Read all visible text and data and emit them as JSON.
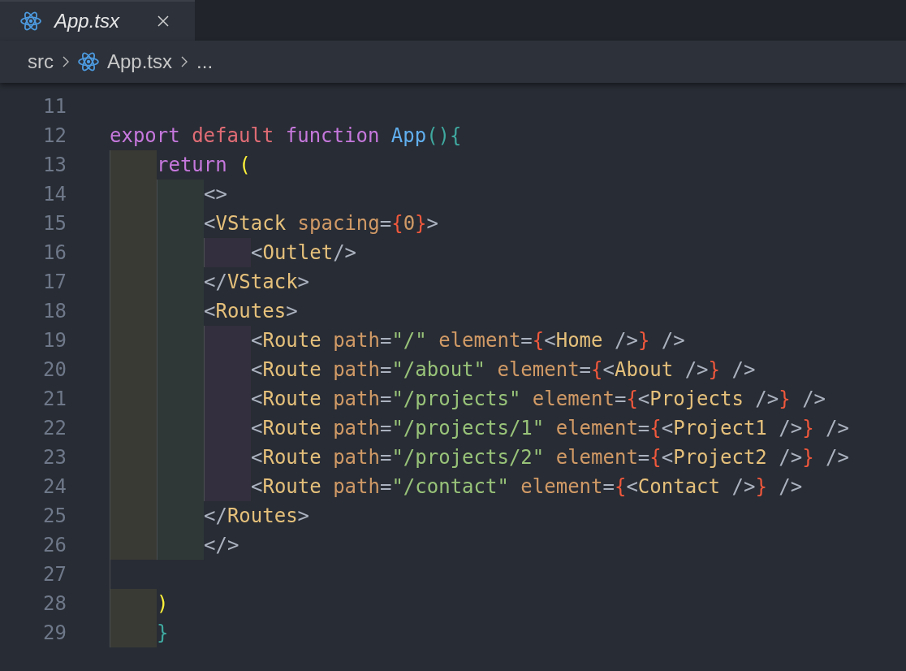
{
  "tab": {
    "title": "App.tsx",
    "selected": true
  },
  "breadcrumb": [
    {
      "label": "src",
      "kind": "folder"
    },
    {
      "label": "App.tsx",
      "kind": "file"
    },
    {
      "label": "...",
      "kind": "more"
    }
  ],
  "lines": [
    {
      "number": "11"
    },
    {
      "number": "12",
      "tokens": [
        {
          "text": "export",
          "kind": "keyword"
        },
        {
          "text": " default",
          "kind": "keyword-alt"
        },
        {
          "text": " function",
          "kind": "keyword"
        },
        {
          "text": " App",
          "kind": "function"
        },
        {
          "text": "(){",
          "kind": "bracket-teal"
        }
      ]
    },
    {
      "number": "13",
      "guides": [
        {
          "kind": "outer"
        }
      ],
      "tokens": [
        {
          "text": "return",
          "kind": "keyword"
        },
        {
          "text": " (",
          "kind": "bracket-yellow"
        }
      ]
    },
    {
      "number": "14",
      "guides": [
        {
          "kind": "outer"
        },
        {
          "kind": "middle"
        }
      ],
      "tokens": [
        {
          "text": "<>",
          "kind": "punct"
        }
      ]
    },
    {
      "number": "15",
      "guides": [
        {
          "kind": "outer"
        },
        {
          "kind": "middle"
        }
      ],
      "tokens": [
        {
          "text": "<",
          "kind": "punct"
        },
        {
          "text": "VStack",
          "kind": "tag"
        },
        {
          "text": " spacing",
          "kind": "attr"
        },
        {
          "text": "=",
          "kind": "punct"
        },
        {
          "text": "{",
          "kind": "brace"
        },
        {
          "text": "0",
          "kind": "attr"
        },
        {
          "text": "}",
          "kind": "brace"
        },
        {
          "text": ">",
          "kind": "punct"
        }
      ]
    },
    {
      "number": "16",
      "guides": [
        {
          "kind": "outer"
        },
        {
          "kind": "middle"
        },
        {
          "kind": "inner"
        }
      ],
      "tokens": [
        {
          "text": "<",
          "kind": "punct"
        },
        {
          "text": "Outlet",
          "kind": "tag"
        },
        {
          "text": "/>",
          "kind": "punct"
        }
      ]
    },
    {
      "number": "17",
      "guides": [
        {
          "kind": "outer"
        },
        {
          "kind": "middle"
        }
      ],
      "tokens": [
        {
          "text": "</",
          "kind": "punct"
        },
        {
          "text": "VStack",
          "kind": "tag"
        },
        {
          "text": ">",
          "kind": "punct"
        }
      ]
    },
    {
      "number": "18",
      "guides": [
        {
          "kind": "outer"
        },
        {
          "kind": "middle"
        }
      ],
      "tokens": [
        {
          "text": "<",
          "kind": "punct"
        },
        {
          "text": "Routes",
          "kind": "tag"
        },
        {
          "text": ">",
          "kind": "punct"
        }
      ]
    },
    {
      "number": "19",
      "guides": [
        {
          "kind": "outer"
        },
        {
          "kind": "middle"
        },
        {
          "kind": "inner"
        }
      ],
      "tokens": [
        {
          "text": "<",
          "kind": "punct"
        },
        {
          "text": "Route",
          "kind": "tag"
        },
        {
          "text": " path",
          "kind": "attr"
        },
        {
          "text": "=",
          "kind": "punct"
        },
        {
          "text": "\"/\"",
          "kind": "string"
        },
        {
          "text": " element",
          "kind": "attr"
        },
        {
          "text": "=",
          "kind": "punct"
        },
        {
          "text": "{",
          "kind": "brace"
        },
        {
          "text": "<",
          "kind": "punct"
        },
        {
          "text": "Home",
          "kind": "tag"
        },
        {
          "text": " />",
          "kind": "punct"
        },
        {
          "text": "}",
          "kind": "brace"
        },
        {
          "text": " />",
          "kind": "punct"
        }
      ]
    },
    {
      "number": "20",
      "guides": [
        {
          "kind": "outer"
        },
        {
          "kind": "middle"
        },
        {
          "kind": "inner"
        }
      ],
      "tokens": [
        {
          "text": "<",
          "kind": "punct"
        },
        {
          "text": "Route",
          "kind": "tag"
        },
        {
          "text": " path",
          "kind": "attr"
        },
        {
          "text": "=",
          "kind": "punct"
        },
        {
          "text": "\"/about\"",
          "kind": "string"
        },
        {
          "text": " element",
          "kind": "attr"
        },
        {
          "text": "=",
          "kind": "punct"
        },
        {
          "text": "{",
          "kind": "brace"
        },
        {
          "text": "<",
          "kind": "punct"
        },
        {
          "text": "About",
          "kind": "tag"
        },
        {
          "text": " />",
          "kind": "punct"
        },
        {
          "text": "}",
          "kind": "brace"
        },
        {
          "text": " />",
          "kind": "punct"
        }
      ]
    },
    {
      "number": "21",
      "guides": [
        {
          "kind": "outer"
        },
        {
          "kind": "middle"
        },
        {
          "kind": "inner"
        }
      ],
      "tokens": [
        {
          "text": "<",
          "kind": "punct"
        },
        {
          "text": "Route",
          "kind": "tag"
        },
        {
          "text": " path",
          "kind": "attr"
        },
        {
          "text": "=",
          "kind": "punct"
        },
        {
          "text": "\"/projects\"",
          "kind": "string"
        },
        {
          "text": " element",
          "kind": "attr"
        },
        {
          "text": "=",
          "kind": "punct"
        },
        {
          "text": "{",
          "kind": "brace"
        },
        {
          "text": "<",
          "kind": "punct"
        },
        {
          "text": "Projects",
          "kind": "tag"
        },
        {
          "text": " />",
          "kind": "punct"
        },
        {
          "text": "}",
          "kind": "brace"
        },
        {
          "text": " />",
          "kind": "punct"
        }
      ]
    },
    {
      "number": "22",
      "guides": [
        {
          "kind": "outer"
        },
        {
          "kind": "middle"
        },
        {
          "kind": "inner"
        }
      ],
      "tokens": [
        {
          "text": "<",
          "kind": "punct"
        },
        {
          "text": "Route",
          "kind": "tag"
        },
        {
          "text": " path",
          "kind": "attr"
        },
        {
          "text": "=",
          "kind": "punct"
        },
        {
          "text": "\"/projects/1\"",
          "kind": "string"
        },
        {
          "text": " element",
          "kind": "attr"
        },
        {
          "text": "=",
          "kind": "punct"
        },
        {
          "text": "{",
          "kind": "brace"
        },
        {
          "text": "<",
          "kind": "punct"
        },
        {
          "text": "Project1",
          "kind": "tag"
        },
        {
          "text": " />",
          "kind": "punct"
        },
        {
          "text": "}",
          "kind": "brace"
        },
        {
          "text": " />",
          "kind": "punct"
        }
      ]
    },
    {
      "number": "23",
      "guides": [
        {
          "kind": "outer"
        },
        {
          "kind": "middle"
        },
        {
          "kind": "inner"
        }
      ],
      "tokens": [
        {
          "text": "<",
          "kind": "punct"
        },
        {
          "text": "Route",
          "kind": "tag"
        },
        {
          "text": " path",
          "kind": "attr"
        },
        {
          "text": "=",
          "kind": "punct"
        },
        {
          "text": "\"/projects/2\"",
          "kind": "string"
        },
        {
          "text": " element",
          "kind": "attr"
        },
        {
          "text": "=",
          "kind": "punct"
        },
        {
          "text": "{",
          "kind": "brace"
        },
        {
          "text": "<",
          "kind": "punct"
        },
        {
          "text": "Project2",
          "kind": "tag"
        },
        {
          "text": " />",
          "kind": "punct"
        },
        {
          "text": "}",
          "kind": "brace"
        },
        {
          "text": " />",
          "kind": "punct"
        }
      ]
    },
    {
      "number": "24",
      "guides": [
        {
          "kind": "outer"
        },
        {
          "kind": "middle"
        },
        {
          "kind": "inner"
        }
      ],
      "tokens": [
        {
          "text": "<",
          "kind": "punct"
        },
        {
          "text": "Route",
          "kind": "tag"
        },
        {
          "text": " path",
          "kind": "attr"
        },
        {
          "text": "=",
          "kind": "punct"
        },
        {
          "text": "\"/contact\"",
          "kind": "string"
        },
        {
          "text": " element",
          "kind": "attr"
        },
        {
          "text": "=",
          "kind": "punct"
        },
        {
          "text": "{",
          "kind": "brace"
        },
        {
          "text": "<",
          "kind": "punct"
        },
        {
          "text": "Contact",
          "kind": "tag"
        },
        {
          "text": " />",
          "kind": "punct"
        },
        {
          "text": "}",
          "kind": "brace"
        },
        {
          "text": " />",
          "kind": "punct"
        }
      ]
    },
    {
      "number": "25",
      "guides": [
        {
          "kind": "outer"
        },
        {
          "kind": "middle"
        }
      ],
      "tokens": [
        {
          "text": "</",
          "kind": "punct"
        },
        {
          "text": "Routes",
          "kind": "tag"
        },
        {
          "text": ">",
          "kind": "punct"
        }
      ]
    },
    {
      "number": "26",
      "guides": [
        {
          "kind": "outer"
        },
        {
          "kind": "middle"
        }
      ],
      "tokens": [
        {
          "text": "</>",
          "kind": "punct"
        }
      ]
    },
    {
      "number": "27",
      "guides": [
        {
          "kind": "empty"
        }
      ]
    },
    {
      "number": "28",
      "guides": [
        {
          "kind": "outer"
        }
      ],
      "tokens": [
        {
          "text": ")",
          "kind": "bracket-yellow"
        }
      ]
    },
    {
      "number": "29",
      "guides": [
        {
          "kind": "outer"
        }
      ],
      "tokens": [
        {
          "text": "}",
          "kind": "bracket-teal"
        }
      ]
    }
  ]
}
